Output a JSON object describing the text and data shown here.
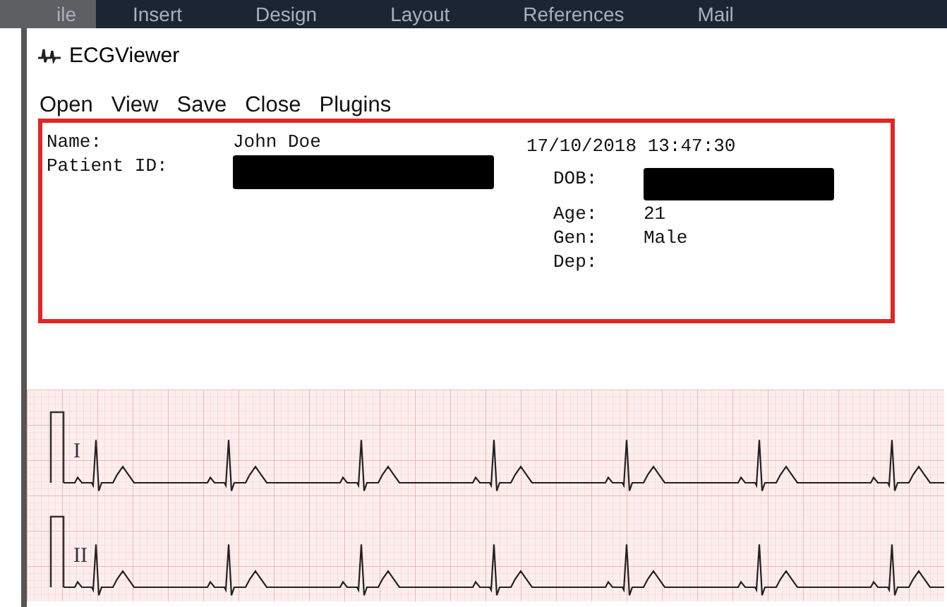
{
  "ribbon_tabs": [
    {
      "label": "ile",
      "selected": true
    },
    {
      "label": "Insert",
      "selected": false
    },
    {
      "label": "Design",
      "selected": false
    },
    {
      "label": "Layout",
      "selected": false
    },
    {
      "label": "References",
      "selected": false
    },
    {
      "label": "Mail",
      "selected": false
    }
  ],
  "window": {
    "title": "ECGViewer"
  },
  "menu": [
    "Open",
    "View",
    "Save",
    "Close",
    "Plugins"
  ],
  "patient": {
    "fields": [
      {
        "label": "Name:",
        "value": "John Doe"
      },
      {
        "label": "Patient ID:",
        "redacted": true
      }
    ],
    "timestamp": "17/10/2018 13:47:30",
    "details": [
      {
        "label": "DOB:",
        "redacted": true
      },
      {
        "label": "Age:",
        "value": "21"
      },
      {
        "label": "Gen:",
        "value": "Male"
      },
      {
        "label": "Dep:"
      }
    ]
  },
  "leads": [
    "I",
    "II"
  ]
}
